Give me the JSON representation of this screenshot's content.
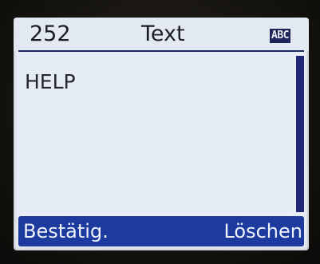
{
  "header": {
    "message_number": "252",
    "title": "Text",
    "input_mode": "ABC",
    "input_mode_icon": "abc-input-mode-icon"
  },
  "editor": {
    "text": "HELP"
  },
  "softkeys": {
    "left_label": "Bestätig.",
    "right_label": "Löschen"
  },
  "colors": {
    "screen_background": "#e9eef6",
    "softkey_bar": "#1d3a9e",
    "scrollbar": "#1e2a78",
    "text": "#1a1c28"
  }
}
